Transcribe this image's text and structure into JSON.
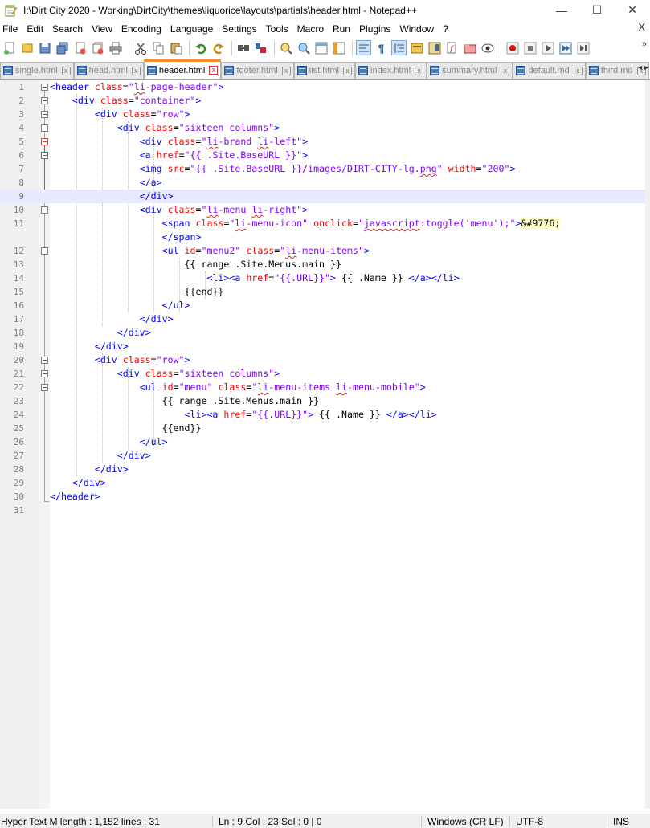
{
  "window": {
    "title": "I:\\Dirt City 2020 - Working\\DirtCity\\themes\\liquorice\\layouts\\partials\\header.html - Notepad++",
    "minimize": "—",
    "maximize": "☐",
    "close": "✕"
  },
  "menu": {
    "items": [
      "File",
      "Edit",
      "Search",
      "View",
      "Encoding",
      "Language",
      "Settings",
      "Tools",
      "Macro",
      "Run",
      "Plugins",
      "Window",
      "?"
    ],
    "close": "X"
  },
  "toolbar": {
    "icons": [
      "new-file-icon",
      "open-file-icon",
      "save-icon",
      "save-all-icon",
      "close-icon",
      "close-all-icon",
      "print-icon",
      "cut-icon",
      "copy-icon",
      "paste-icon",
      "undo-icon",
      "redo-icon",
      "find-icon",
      "replace-icon",
      "zoom-in-icon",
      "zoom-out-icon",
      "sync-vertical-icon",
      "sync-horizontal-icon",
      "word-wrap-icon",
      "show-all-chars-icon",
      "indent-guide-icon",
      "language-icon",
      "doc-map-icon",
      "function-list-icon",
      "folder-workspace-icon",
      "monitor-icon",
      "record-macro-icon",
      "stop-record-icon",
      "play-macro-icon",
      "run-macro-multiple-icon",
      "save-macro-icon"
    ],
    "more": "»"
  },
  "tabs": [
    {
      "label": "single.html",
      "active": false
    },
    {
      "label": "head.html",
      "active": false
    },
    {
      "label": "header.html",
      "active": true
    },
    {
      "label": "footer.html",
      "active": false
    },
    {
      "label": "list.html",
      "active": false
    },
    {
      "label": "index.html",
      "active": false
    },
    {
      "label": "summary.html",
      "active": false
    },
    {
      "label": "default.md",
      "active": false
    },
    {
      "label": "third.md",
      "active": false
    }
  ],
  "tab_close": "x",
  "tab_arrows": "◂ ▸",
  "editor": {
    "current_line": 9,
    "lines": [
      "1",
      "2",
      "3",
      "4",
      "5",
      "6",
      "7",
      "8",
      "9",
      "10",
      "11",
      "",
      "12",
      "13",
      "14",
      "15",
      "16",
      "17",
      "18",
      "19",
      "20",
      "21",
      "22",
      "23",
      "24",
      "25",
      "26",
      "27",
      "28",
      "29",
      "30",
      "31"
    ]
  },
  "statusbar": {
    "doc_type": "Hyper Text M length : 1,152    lines : 31",
    "position": "Ln : 9    Col : 23    Sel : 0 | 0",
    "eol": "Windows (CR LF)",
    "encoding": "UTF-8",
    "mode": "INS"
  },
  "colors": {
    "tag": "#0000ff",
    "attribute": "#ff0000",
    "value": "#8000ff",
    "active_tab_accent": "#fa8c24",
    "current_line": "#e8e8ff"
  }
}
